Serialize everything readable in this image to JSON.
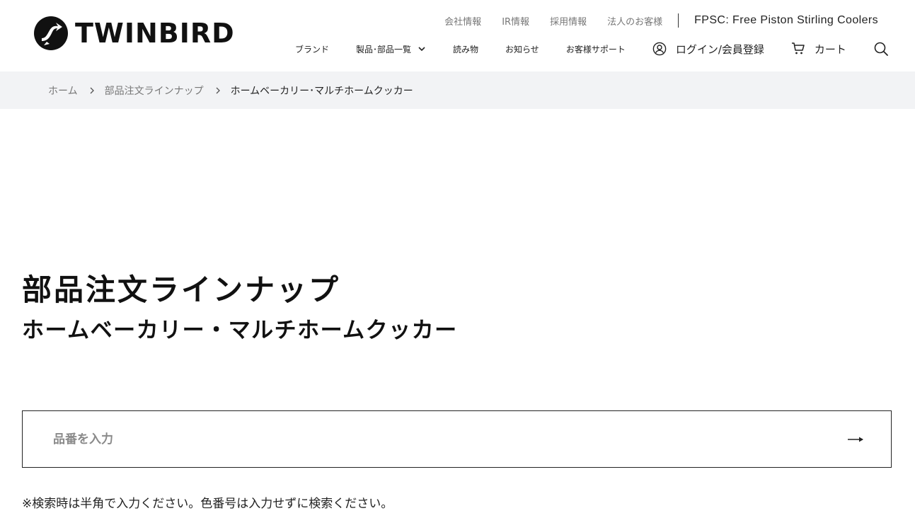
{
  "header": {
    "logo_text": "TWINBIRD",
    "top_links": [
      "会社情報",
      "IR情報",
      "採用情報",
      "法人のお客様"
    ],
    "fpsc_link": "FPSC: Free Piston Stirling Coolers",
    "nav": {
      "brand": "ブランド",
      "products": "製品･部品一覧",
      "reading": "読み物",
      "news": "お知らせ",
      "support": "お客様サポート",
      "login": "ログイン/会員登録",
      "cart": "カート"
    }
  },
  "breadcrumb": {
    "home": "ホーム",
    "parts": "部品注文ラインナップ",
    "current": "ホームベーカリー･マルチホームクッカー"
  },
  "page": {
    "title": "部品注文ラインナップ",
    "subtitle": "ホームベーカリー・マルチホームクッカー"
  },
  "search": {
    "placeholder": "品番を入力",
    "value": ""
  },
  "note": "※検索時は半角で入力ください。色番号は入力せずに検索ください。",
  "colors": {
    "breadcrumb_bg": "#f2f3f5",
    "text": "#1a1a1a",
    "muted": "#777777"
  },
  "icons": {
    "logo": "twinbird-logo-icon",
    "chevron": "chevron-down-icon",
    "user": "user-circle-icon",
    "cart": "cart-icon",
    "search": "search-icon",
    "breadcrumb_sep": "chevron-right-icon",
    "submit": "arrow-right-icon"
  }
}
